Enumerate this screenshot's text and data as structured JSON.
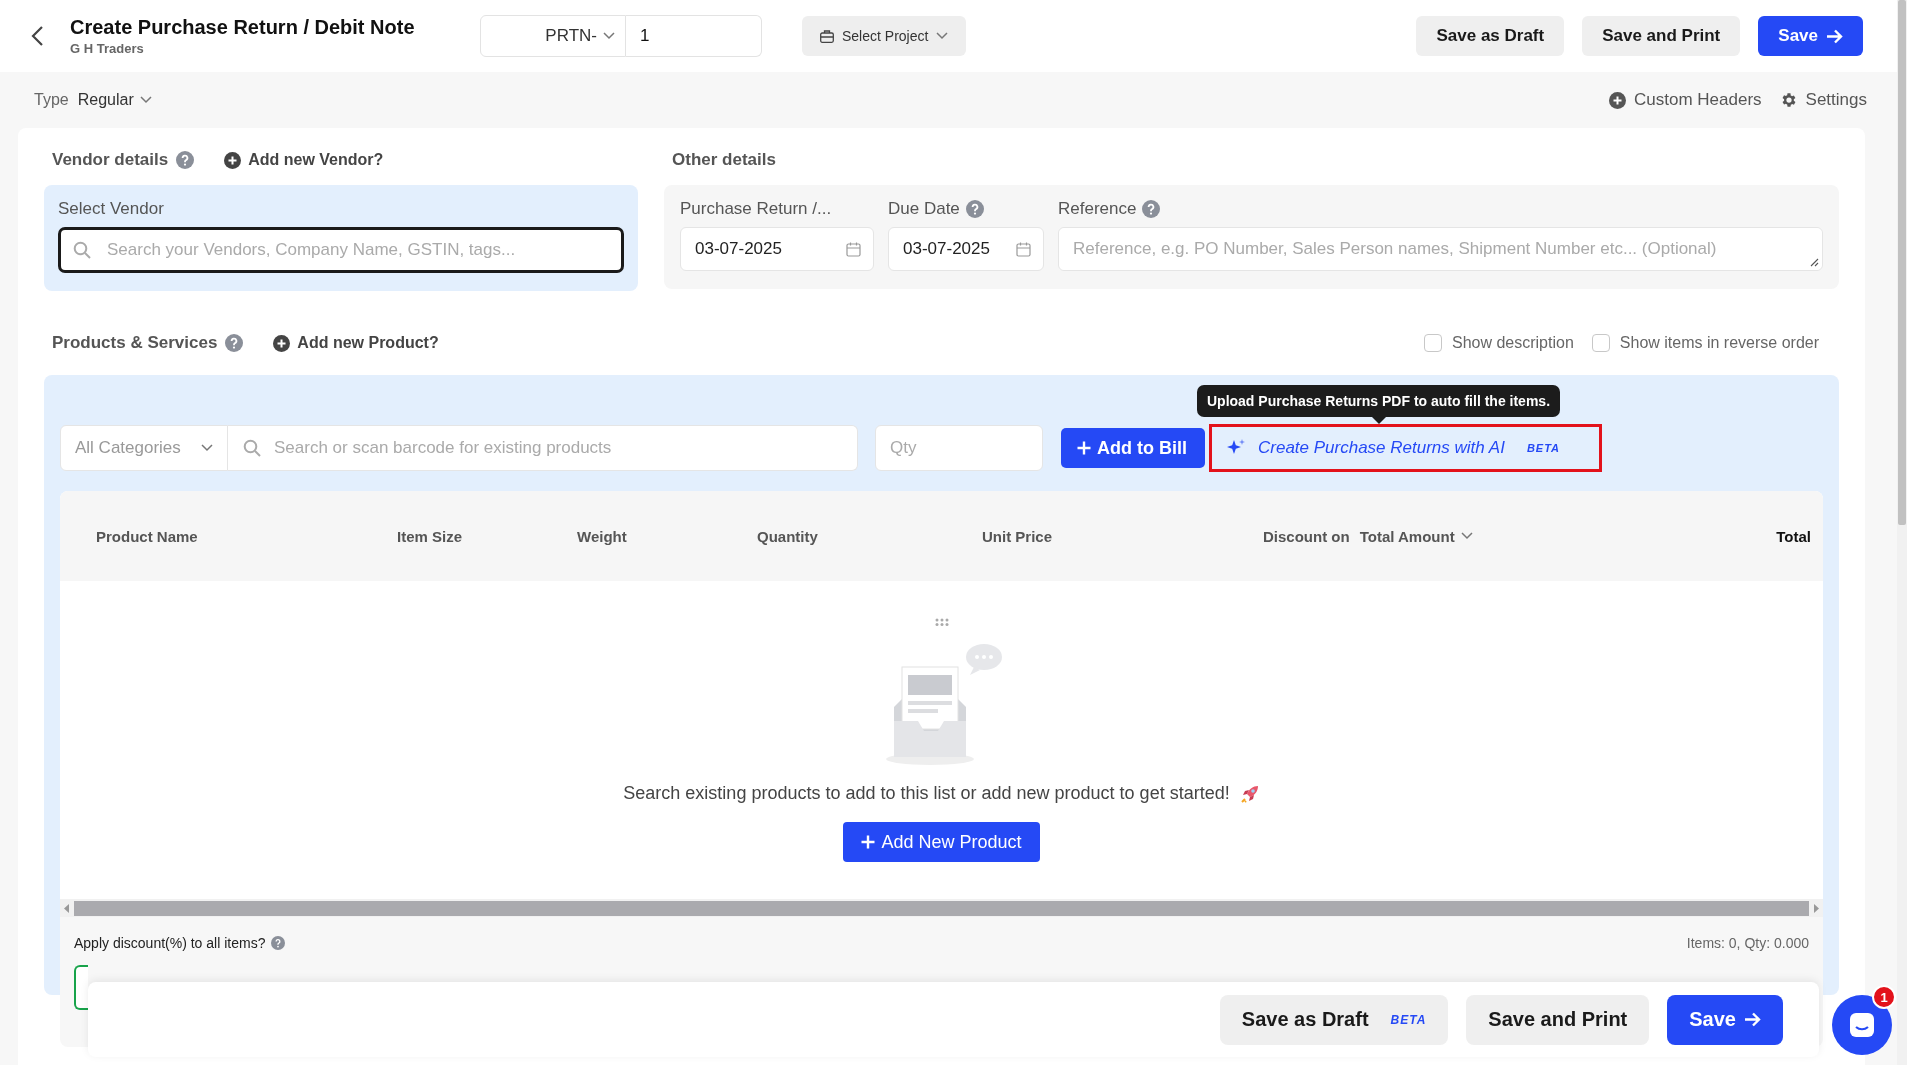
{
  "header": {
    "title": "Create Purchase Return / Debit Note",
    "subtitle": "G H Traders",
    "prefix": "PRTN-",
    "number": "1",
    "project": "Select Project",
    "buttons": [
      {
        "label": "Save as Draft",
        "kind": "secondary"
      },
      {
        "label": "Save and Print",
        "kind": "secondary"
      },
      {
        "label": "Save",
        "kind": "primary"
      }
    ]
  },
  "type": {
    "label": "Type",
    "value": "Regular"
  },
  "links": [
    {
      "label": "Custom Headers",
      "kind": "plus"
    },
    {
      "label": "Settings",
      "kind": "gear"
    }
  ],
  "vendor": {
    "heading": "Vendor details",
    "add_link": "Add new Vendor?",
    "field_label": "Select Vendor",
    "placeholder": "Search your Vendors, Company Name, GSTIN, tags..."
  },
  "other_details": {
    "heading": "Other details",
    "fields": [
      {
        "kind": "date",
        "label": "Purchase Return /...",
        "value": "03-07-2025",
        "help": false
      },
      {
        "kind": "date",
        "label": "Due Date",
        "value": "03-07-2025",
        "help": true
      },
      {
        "kind": "textarea",
        "label": "Reference",
        "placeholder": "Reference, e.g. PO Number, Sales Person names, Shipment Number etc... (Optional)",
        "help": true
      }
    ]
  },
  "products": {
    "heading": "Products & Services",
    "add_link": "Add new Product?",
    "options": [
      {
        "label": "Show description",
        "checked": false
      },
      {
        "label": "Show items in reverse order",
        "checked": false
      }
    ],
    "category": "All Categories",
    "search_placeholder": "Search or scan barcode for existing products",
    "qty_placeholder": "Qty",
    "add_button": "Add to Bill",
    "ai_button": {
      "label": "Create Purchase Returns with AI",
      "badge": "BETA",
      "highlighted": true
    },
    "tooltip": "Upload Purchase Returns PDF to auto fill the items.",
    "table": {
      "columns": [
        {
          "label": "Product Name",
          "bold": false
        },
        {
          "label": "Item Size",
          "bold": false
        },
        {
          "label": "Weight",
          "bold": false
        },
        {
          "label": "Quantity",
          "bold": false
        },
        {
          "label": "Unit Price",
          "bold": false
        },
        {
          "label": "Discount on",
          "select": "Total Amount",
          "bold": false
        },
        {
          "label": "Total",
          "bold": true
        }
      ]
    },
    "empty_message": "Search existing products to add to this list or add new product to get started!",
    "add_new_button": "Add New Product"
  },
  "summary": {
    "discount_label": "Apply discount(%) to all items?",
    "totals": "Items: 0, Qty: 0.000"
  },
  "footer_bar": {
    "buttons": [
      {
        "label": "Save as Draft",
        "kind": "secondary",
        "badge": "BETA"
      },
      {
        "label": "Save and Print",
        "kind": "secondary"
      },
      {
        "label": "Save",
        "kind": "primary"
      }
    ]
  },
  "chat": {
    "badge": "1"
  }
}
